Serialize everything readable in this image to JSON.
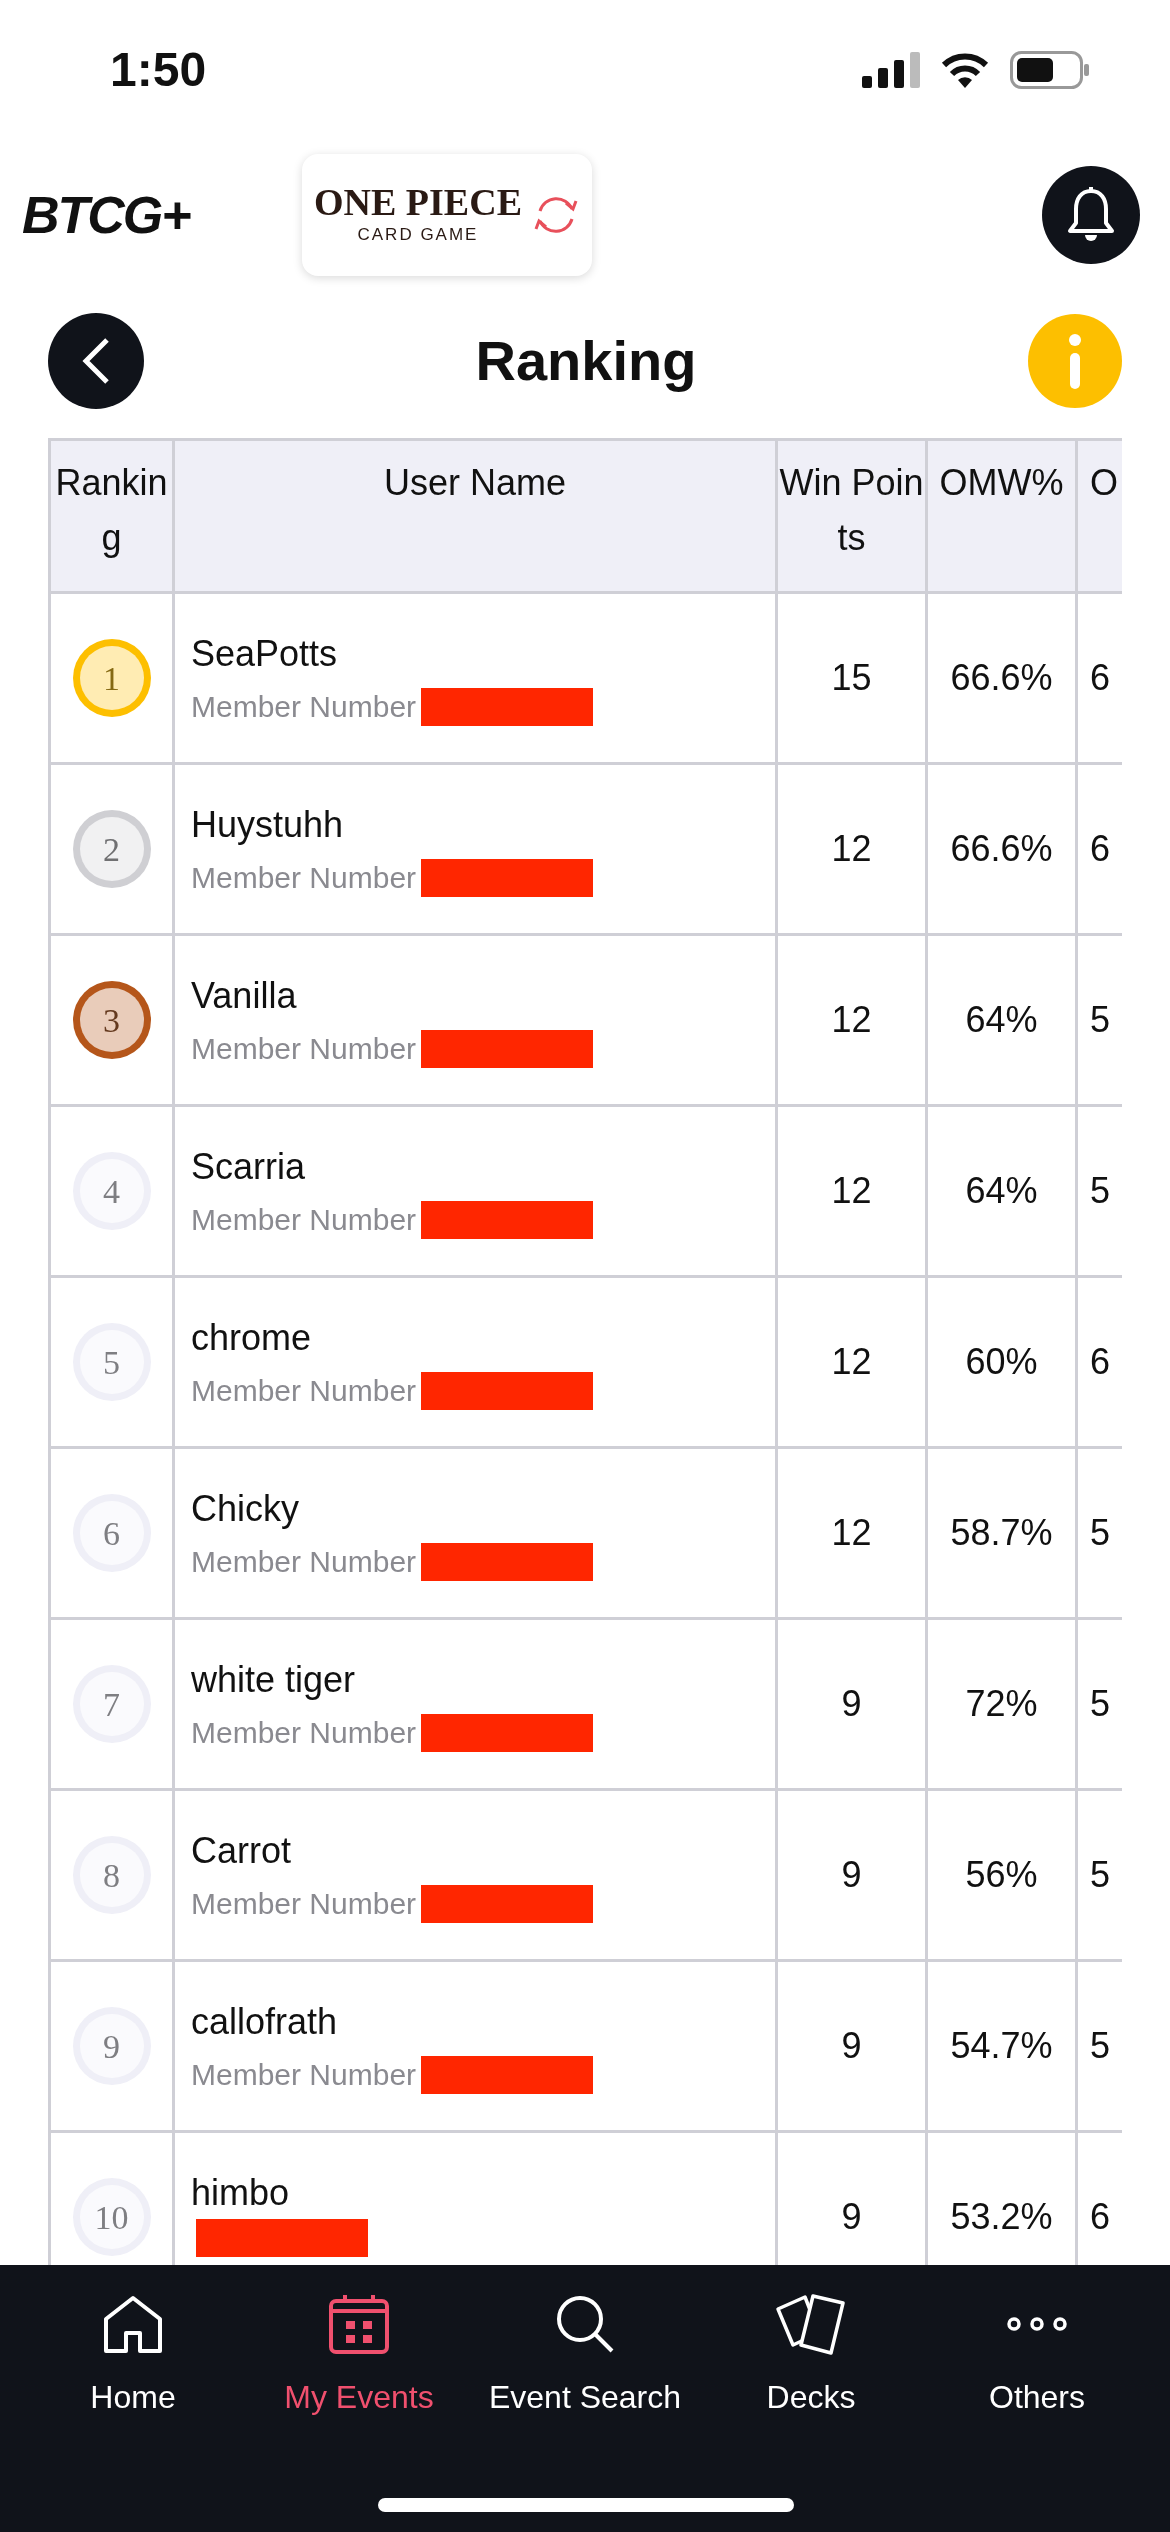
{
  "status_bar": {
    "time": "1:50"
  },
  "header": {
    "brand": "BTCG+",
    "game_logo": {
      "title": "ONE PIECE",
      "subtitle": "CARD GAME"
    }
  },
  "title": "Ranking",
  "table": {
    "columns": [
      "Ranking",
      "User Name",
      "Win Points",
      "OMW%",
      "O"
    ],
    "rows": [
      {
        "rank": "1",
        "color": "#fdbf00",
        "name": "SeaPotts",
        "member_label": "Member Number",
        "win_points": "15",
        "omw": "66.6%",
        "column_5": "6"
      },
      {
        "rank": "2",
        "color": "#cfcfd3",
        "name": "Huystuhh",
        "member_label": "Member Number",
        "win_points": "12",
        "omw": "66.6%",
        "column_5": "6"
      },
      {
        "rank": "3",
        "color": "#b5561a",
        "name": "Vanilla",
        "member_label": "Member Number",
        "win_points": "12",
        "omw": "64%",
        "column_5": "5"
      },
      {
        "rank": "4",
        "color": "#efeff7",
        "name": "Scarria",
        "member_label": "Member Number",
        "win_points": "12",
        "omw": "64%",
        "column_5": "5"
      },
      {
        "rank": "5",
        "color": "#efeff7",
        "name": "chrome",
        "member_label": "Member Number",
        "win_points": "12",
        "omw": "60%",
        "column_5": "6"
      },
      {
        "rank": "6",
        "color": "#efeff7",
        "name": "Chicky",
        "member_label": "Member Number",
        "win_points": "12",
        "omw": "58.7%",
        "column_5": "5"
      },
      {
        "rank": "7",
        "color": "#efeff7",
        "name": "white tiger",
        "member_label": "Member Number",
        "win_points": "9",
        "omw": "72%",
        "column_5": "5"
      },
      {
        "rank": "8",
        "color": "#efeff7",
        "name": "Carrot",
        "member_label": "Member Number",
        "win_points": "9",
        "omw": "56%",
        "column_5": "5"
      },
      {
        "rank": "9",
        "color": "#efeff7",
        "name": "callofrath",
        "member_label": "Member Number",
        "win_points": "9",
        "omw": "54.7%",
        "column_5": "5"
      },
      {
        "rank": "10",
        "color": "#efeff7",
        "name": "himbo",
        "win_points": "9",
        "omw": "53.2%",
        "column_5": "6"
      }
    ]
  },
  "tab_bar": [
    {
      "label": "Home",
      "kind": "home",
      "selected": false
    },
    {
      "label": "My Events",
      "kind": "events",
      "selected": true
    },
    {
      "label": "Event Search",
      "kind": "search",
      "selected": false
    },
    {
      "label": "Decks",
      "kind": "decks",
      "selected": false
    },
    {
      "label": "Others",
      "kind": "others",
      "selected": false
    }
  ]
}
